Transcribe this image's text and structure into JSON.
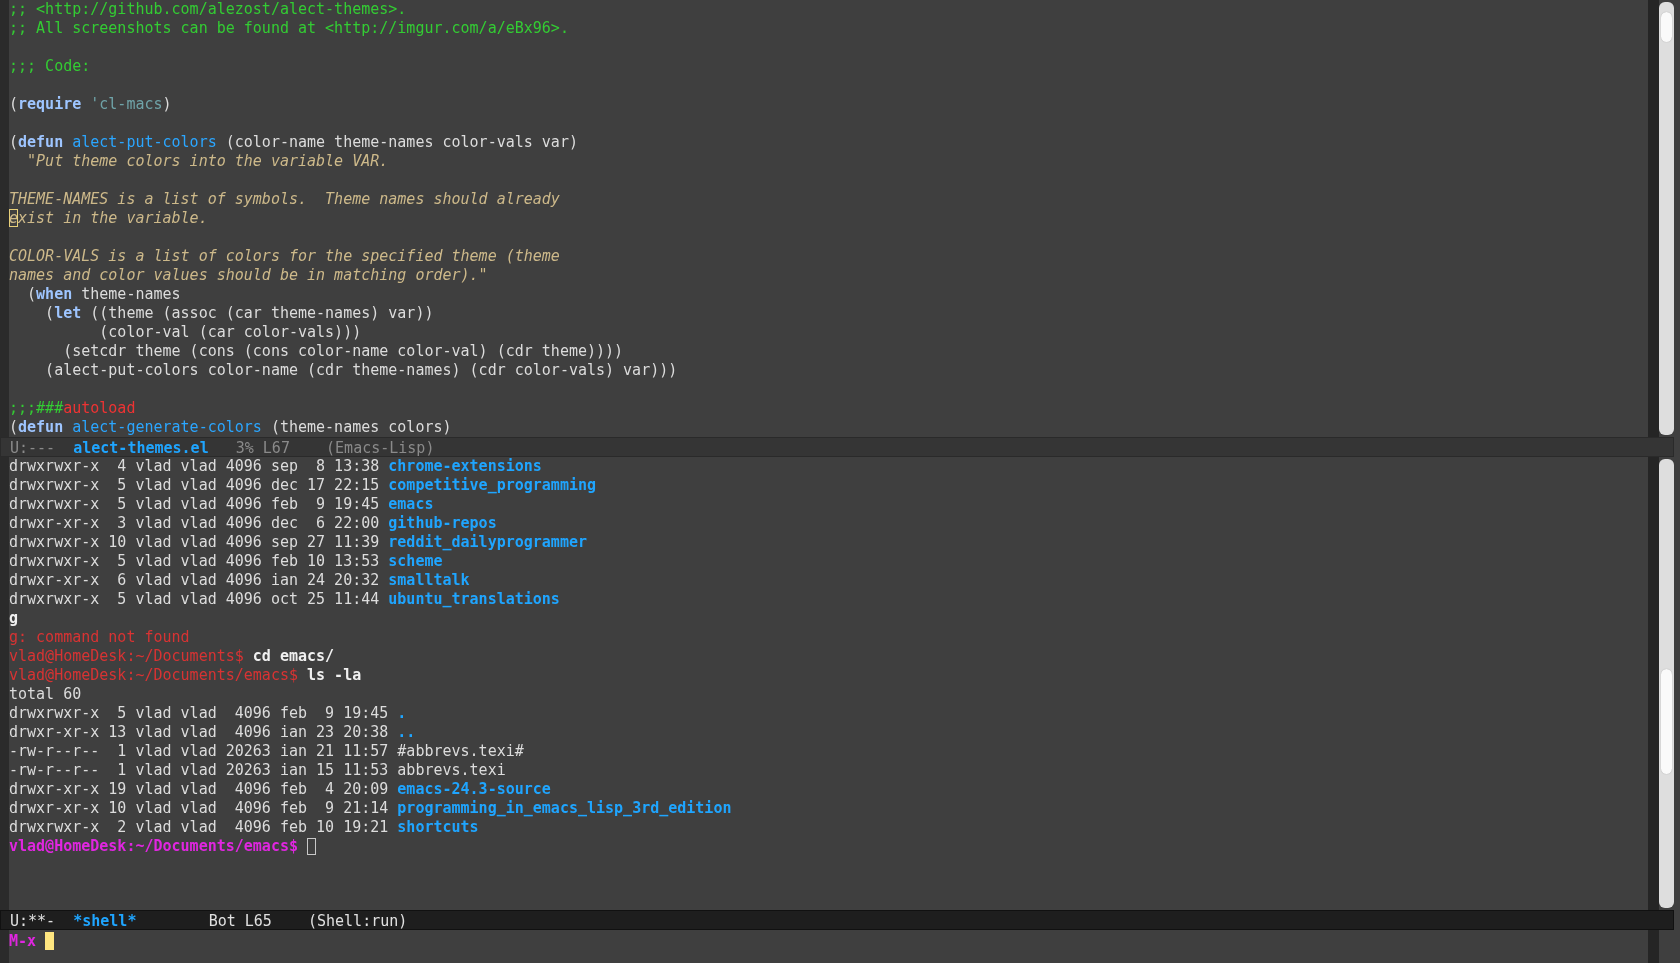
{
  "editor_window": {
    "lines": [
      {
        "kind": "code",
        "segs": [
          {
            "kind": "comment",
            "text": ";; <http://github.com/alezost/alect-themes>."
          }
        ]
      },
      {
        "kind": "code",
        "segs": [
          {
            "kind": "comment",
            "text": ";; All screenshots can be found at <http://imgur.com/a/eBx96>."
          }
        ]
      },
      {
        "kind": "blank"
      },
      {
        "kind": "code",
        "segs": [
          {
            "kind": "comment",
            "text": ";;; Code:"
          }
        ]
      },
      {
        "kind": "blank"
      },
      {
        "kind": "code",
        "segs": [
          {
            "kind": "plain",
            "text": "("
          },
          {
            "kind": "keyword",
            "text": "require"
          },
          {
            "kind": "constant",
            "text": " 'cl-macs"
          },
          {
            "kind": "plain",
            "text": ")"
          }
        ]
      },
      {
        "kind": "blank"
      },
      {
        "kind": "code",
        "segs": [
          {
            "kind": "plain",
            "text": "("
          },
          {
            "kind": "keyword",
            "text": "defun"
          },
          {
            "kind": "function",
            "text": " alect-put-colors"
          },
          {
            "kind": "plain",
            "text": " (color-name theme-names color-vals var)"
          }
        ]
      },
      {
        "kind": "code",
        "segs": [
          {
            "kind": "doc",
            "text": "  \"Put theme colors into the variable VAR."
          }
        ]
      },
      {
        "kind": "blank"
      },
      {
        "kind": "code",
        "segs": [
          {
            "kind": "doc",
            "text": "THEME-NAMES is a list of symbols.  Theme names should already"
          }
        ]
      },
      {
        "kind": "code",
        "segs": [
          {
            "kind": "cursor",
            "text": "e"
          },
          {
            "kind": "doc",
            "text": "xist in the variable."
          }
        ]
      },
      {
        "kind": "blank"
      },
      {
        "kind": "code",
        "segs": [
          {
            "kind": "doc",
            "text": "COLOR-VALS is a list of colors for the specified theme (theme"
          }
        ]
      },
      {
        "kind": "code",
        "segs": [
          {
            "kind": "doc",
            "text": "names and color values should be in matching order).\""
          }
        ]
      },
      {
        "kind": "code",
        "segs": [
          {
            "kind": "plain",
            "text": "  ("
          },
          {
            "kind": "keyword",
            "text": "when"
          },
          {
            "kind": "plain",
            "text": " theme-names"
          }
        ]
      },
      {
        "kind": "code",
        "segs": [
          {
            "kind": "plain",
            "text": "    ("
          },
          {
            "kind": "keyword",
            "text": "let"
          },
          {
            "kind": "plain",
            "text": " ((theme (assoc (car theme-names) var))"
          }
        ]
      },
      {
        "kind": "code",
        "segs": [
          {
            "kind": "plain",
            "text": "          (color-val (car color-vals)))"
          }
        ]
      },
      {
        "kind": "code",
        "segs": [
          {
            "kind": "plain",
            "text": "      (setcdr theme (cons (cons color-name color-val) (cdr theme))))"
          }
        ]
      },
      {
        "kind": "code",
        "segs": [
          {
            "kind": "plain",
            "text": "    (alect-put-colors color-name (cdr theme-names) (cdr color-vals) var)))"
          }
        ]
      },
      {
        "kind": "blank"
      },
      {
        "kind": "code",
        "segs": [
          {
            "kind": "comment",
            "text": ";;;###"
          },
          {
            "kind": "warning",
            "text": "autoload"
          }
        ]
      },
      {
        "kind": "code",
        "segs": [
          {
            "kind": "plain",
            "text": "("
          },
          {
            "kind": "keyword",
            "text": "defun"
          },
          {
            "kind": "function",
            "text": " alect-generate-colors"
          },
          {
            "kind": "plain",
            "text": " (theme-names colors)"
          }
        ]
      }
    ],
    "mode_line": {
      "active": false,
      "status": "U:---",
      "buffer": "alect-themes.el",
      "position": "3% L67",
      "mode": "(Emacs-Lisp)"
    }
  },
  "shell_window": {
    "lines": [
      {
        "segs": [
          {
            "kind": "plain",
            "text": "drwxrwxr-x  4 vlad vlad 4096 sep  8 13:38 "
          },
          {
            "kind": "dir",
            "text": "chrome-extensions"
          }
        ]
      },
      {
        "segs": [
          {
            "kind": "plain",
            "text": "drwxrwxr-x  5 vlad vlad 4096 dec 17 22:15 "
          },
          {
            "kind": "dir",
            "text": "competitive_programming"
          }
        ]
      },
      {
        "segs": [
          {
            "kind": "plain",
            "text": "drwxrwxr-x  5 vlad vlad 4096 feb  9 19:45 "
          },
          {
            "kind": "dir",
            "text": "emacs"
          }
        ]
      },
      {
        "segs": [
          {
            "kind": "plain",
            "text": "drwxr-xr-x  3 vlad vlad 4096 dec  6 22:00 "
          },
          {
            "kind": "dir",
            "text": "github-repos"
          }
        ]
      },
      {
        "segs": [
          {
            "kind": "plain",
            "text": "drwxrwxr-x 10 vlad vlad 4096 sep 27 11:39 "
          },
          {
            "kind": "dir",
            "text": "reddit_dailyprogrammer"
          }
        ]
      },
      {
        "segs": [
          {
            "kind": "plain",
            "text": "drwxrwxr-x  5 vlad vlad 4096 feb 10 13:53 "
          },
          {
            "kind": "dir",
            "text": "scheme"
          }
        ]
      },
      {
        "segs": [
          {
            "kind": "plain",
            "text": "drwxr-xr-x  6 vlad vlad 4096 ian 24 20:32 "
          },
          {
            "kind": "dir",
            "text": "smalltalk"
          }
        ]
      },
      {
        "segs": [
          {
            "kind": "plain",
            "text": "drwxrwxr-x  5 vlad vlad 4096 oct 25 11:44 "
          },
          {
            "kind": "dir",
            "text": "ubuntu_translations"
          }
        ]
      },
      {
        "segs": [
          {
            "kind": "command",
            "text": "g"
          }
        ]
      },
      {
        "segs": [
          {
            "kind": "error",
            "text": "g: command not found"
          }
        ]
      },
      {
        "segs": [
          {
            "kind": "prompt",
            "text": "vlad@HomeDesk:~/Documents$ "
          },
          {
            "kind": "command",
            "text": "cd emacs/"
          }
        ]
      },
      {
        "segs": [
          {
            "kind": "prompt",
            "text": "vlad@HomeDesk:~/Documents/emacs$ "
          },
          {
            "kind": "command",
            "text": "ls -la"
          }
        ]
      },
      {
        "segs": [
          {
            "kind": "plain",
            "text": "total 60"
          }
        ]
      },
      {
        "segs": [
          {
            "kind": "plain",
            "text": "drwxrwxr-x  5 vlad vlad  4096 feb  9 19:45 "
          },
          {
            "kind": "dir",
            "text": "."
          }
        ]
      },
      {
        "segs": [
          {
            "kind": "plain",
            "text": "drwxr-xr-x 13 vlad vlad  4096 ian 23 20:38 "
          },
          {
            "kind": "dir",
            "text": ".."
          }
        ]
      },
      {
        "segs": [
          {
            "kind": "plain",
            "text": "-rw-r--r--  1 vlad vlad 20263 ian 21 11:57 #abbrevs.texi#"
          }
        ]
      },
      {
        "segs": [
          {
            "kind": "plain",
            "text": "-rw-r--r--  1 vlad vlad 20263 ian 15 11:53 abbrevs.texi"
          }
        ]
      },
      {
        "segs": [
          {
            "kind": "plain",
            "text": "drwxr-xr-x 19 vlad vlad  4096 feb  4 20:09 "
          },
          {
            "kind": "dir",
            "text": "emacs-24.3-source"
          }
        ]
      },
      {
        "segs": [
          {
            "kind": "plain",
            "text": "drwxr-xr-x 10 vlad vlad  4096 feb  9 21:14 "
          },
          {
            "kind": "dir",
            "text": "programming_in_emacs_lisp_3rd_edition"
          }
        ]
      },
      {
        "segs": [
          {
            "kind": "plain",
            "text": "drwxrwxr-x  2 vlad vlad  4096 feb 10 19:21 "
          },
          {
            "kind": "dir",
            "text": "shortcuts"
          }
        ]
      },
      {
        "segs": [
          {
            "kind": "current-prompt",
            "text": "vlad@HomeDesk:~/Documents/emacs$"
          }
        ],
        "cursor": true
      }
    ],
    "mode_line": {
      "active": true,
      "status": "U:**-",
      "buffer": "*shell*",
      "position": "Bot L65",
      "mode": "(Shell:run)"
    }
  },
  "minibuffer": {
    "prompt": "M-x",
    "cursor": true
  }
}
